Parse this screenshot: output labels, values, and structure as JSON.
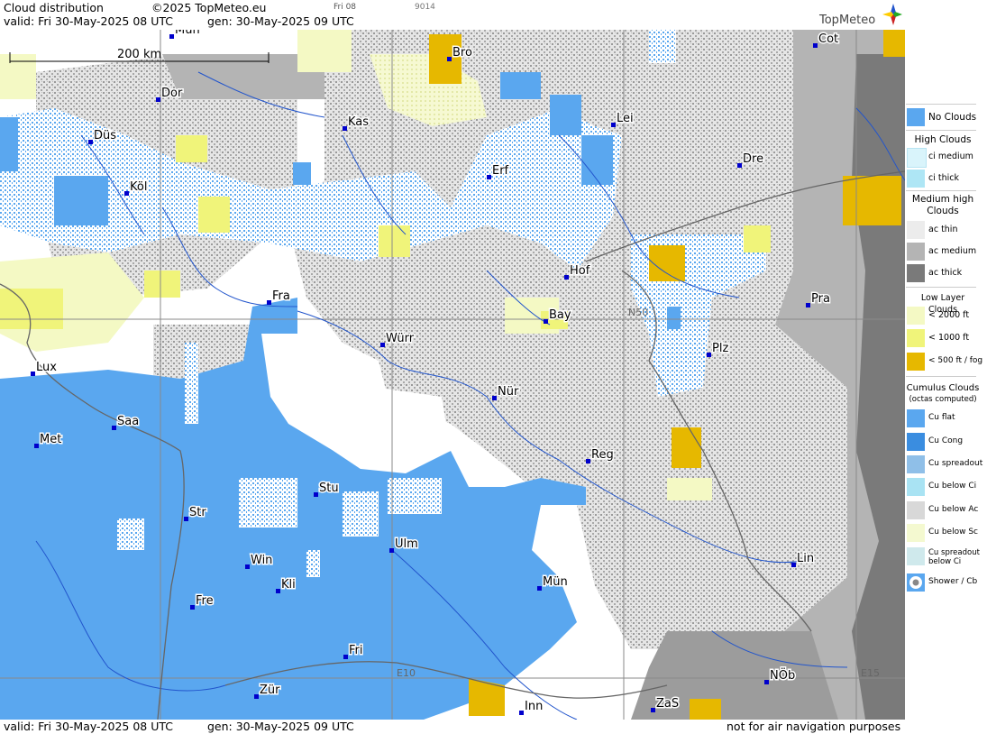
{
  "header": {
    "title": "Cloud distribution",
    "copyright": "©2025 TopMeteo.eu",
    "frame_label": "Fri 08",
    "code": "9014",
    "valid": "valid:  Fri  30-May-2025  08 UTC",
    "gen": "gen: 30-May-2025 09 UTC",
    "brand": "TopMeteo"
  },
  "scale": {
    "label": "200 km"
  },
  "cities": [
    {
      "name": "Mün"
    },
    {
      "name": "Bro"
    },
    {
      "name": "Cot"
    },
    {
      "name": "Dor"
    },
    {
      "name": "Kas"
    },
    {
      "name": "Lei"
    },
    {
      "name": "Düs"
    },
    {
      "name": "Erf"
    },
    {
      "name": "Dre"
    },
    {
      "name": "Köl"
    },
    {
      "name": "Hof"
    },
    {
      "name": "Fra"
    },
    {
      "name": "Pra"
    },
    {
      "name": "Bay"
    },
    {
      "name": "Würr"
    },
    {
      "name": "Plz"
    },
    {
      "name": "Lux"
    },
    {
      "name": "Nür"
    },
    {
      "name": "Saa"
    },
    {
      "name": "Met"
    },
    {
      "name": "Reg"
    },
    {
      "name": "Stu"
    },
    {
      "name": "Str"
    },
    {
      "name": "Ulm"
    },
    {
      "name": "Win"
    },
    {
      "name": "Lin"
    },
    {
      "name": "Kli"
    },
    {
      "name": "Mün"
    },
    {
      "name": "Fre"
    },
    {
      "name": "Fri"
    },
    {
      "name": "NÖb"
    },
    {
      "name": "Zür"
    },
    {
      "name": "ZaS"
    },
    {
      "name": "Inn"
    }
  ],
  "grid_labels": {
    "lat": "N50",
    "lon1": "E10",
    "lon2": "E15"
  },
  "footer": {
    "valid": "valid:  Fri  30-May-2025  08 UTC",
    "gen": "gen: 30-May-2025 09 UTC",
    "note": "not for air navigation purposes"
  },
  "legend": {
    "no_clouds": "No Clouds",
    "high_head": "High Clouds",
    "ci_medium": "ci medium",
    "ci_thick": "ci thick",
    "medium_head": "Medium high Clouds",
    "ac_thin": "ac thin",
    "ac_medium": "ac medium",
    "ac_thick": "ac thick",
    "low_head": "Low Layer Clouds",
    "low_2000": "< 2000 ft",
    "low_1000": "< 1000 ft",
    "low_500": "< 500 ft / fog",
    "cu_head": "Cumulus Clouds",
    "cu_sub": "(octas computed)",
    "cu_flat": "Cu flat",
    "cu_cong": "Cu Cong",
    "cu_spread": "Cu spreadout",
    "cu_below_ci": "Cu below Ci",
    "cu_below_ac": "Cu below Ac",
    "cu_below_sc": "Cu below Sc",
    "cu_spread_ci": "Cu spreadout below Ci",
    "shower": "Shower / Cb"
  },
  "colors": {
    "no_clouds": "#5aa7ef",
    "ac_medium": "#b4b4b4",
    "ac_thick": "#7a7a7a",
    "low_2000": "#f4f9c4",
    "low_1000": "#f0f47a",
    "fog": "#e6b800",
    "city": "#0000cc",
    "river": "#2255cc"
  }
}
